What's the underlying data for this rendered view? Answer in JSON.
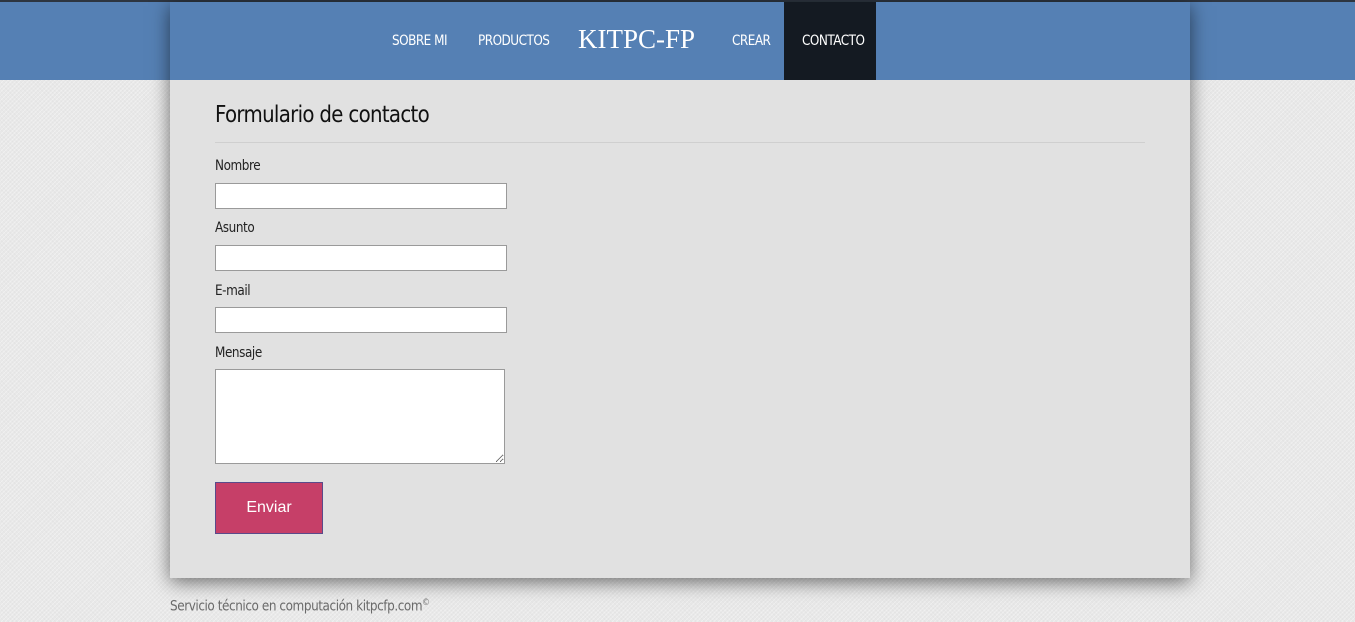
{
  "nav": {
    "items": [
      {
        "label": "SOBRE MI"
      },
      {
        "label": "PRODUCTOS"
      },
      {
        "label": "CREAR"
      },
      {
        "label": "CONTACTO",
        "active": true
      }
    ],
    "brand": "KITPC-FP"
  },
  "form": {
    "title": "Formulario de contacto",
    "fields": {
      "nombre": {
        "label": "Nombre",
        "value": ""
      },
      "asunto": {
        "label": "Asunto",
        "value": ""
      },
      "email": {
        "label": "E-mail",
        "value": ""
      },
      "mensaje": {
        "label": "Mensaje",
        "value": ""
      }
    },
    "submit_label": "Enviar"
  },
  "footer": {
    "text": "Servicio técnico en computación kitpcfp.com",
    "copyright_mark": "©"
  },
  "colors": {
    "nav_background": "#5580b4",
    "nav_active": "#141a22",
    "submit_button": "#c63f68"
  }
}
